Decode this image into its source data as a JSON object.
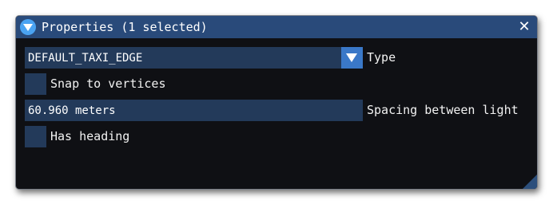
{
  "window": {
    "title": "Properties (1 selected)",
    "close_icon": "close-icon",
    "collapse_icon": "collapse-arrow-icon"
  },
  "fields": {
    "type": {
      "value": "DEFAULT_TAXI_EDGE",
      "label": "Type"
    },
    "snap": {
      "label": "Snap to vertices",
      "checked": false
    },
    "spacing": {
      "value": "60.960 meters",
      "label": "Spacing between light"
    },
    "heading": {
      "label": "Has heading",
      "checked": false
    }
  },
  "colors": {
    "title_bar": "#294a7a",
    "frame_bg": "#233a5a",
    "button_accent": "#3a78c8",
    "collapse_icon": "#4aa3f2",
    "window_bg": "#0f1014"
  }
}
